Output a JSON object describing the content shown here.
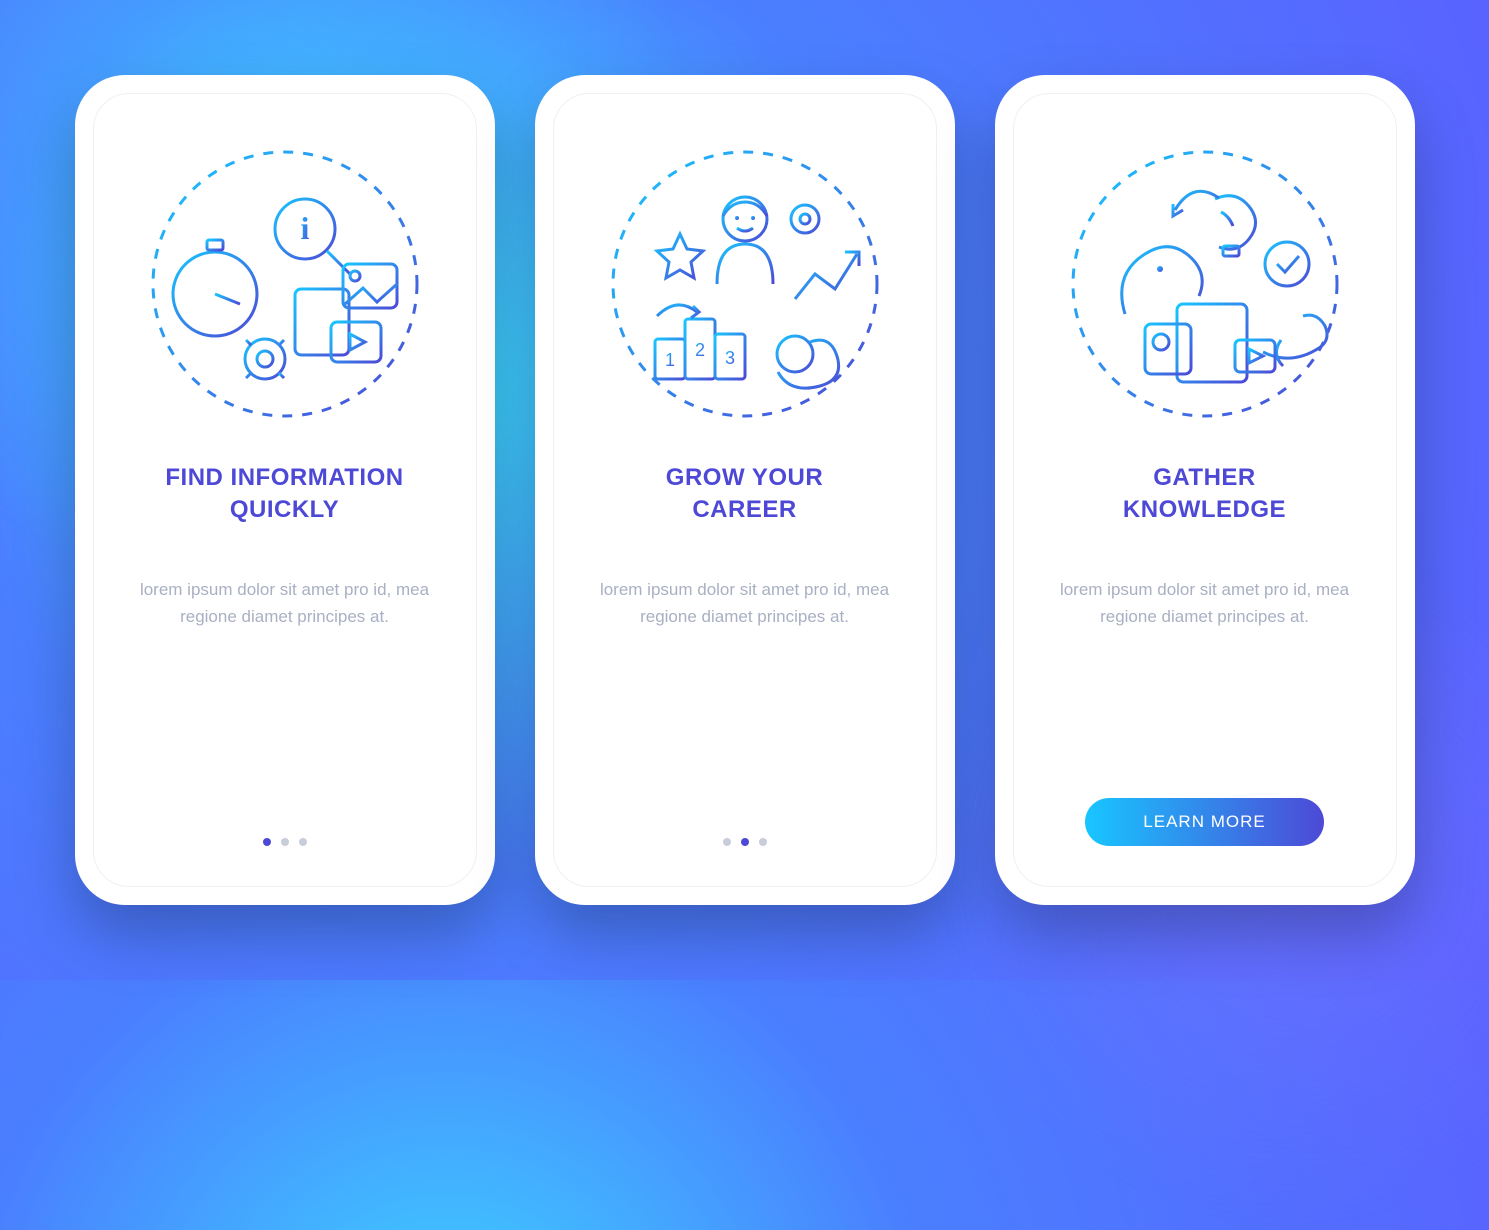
{
  "colors": {
    "title": "#4d49d6",
    "desc": "#a9b0c3",
    "dot_inactive": "#c7cdd9",
    "dot_active": "#4d49d6",
    "cta_grad_start": "#18c6ff",
    "cta_grad_end": "#4d49d6"
  },
  "screens": [
    {
      "illustration": "info-search-icon",
      "title": "FIND INFORMATION\nQUICKLY",
      "description": "lorem ipsum dolor sit amet pro id, mea regione diamet principes at.",
      "active_dot_index": 0,
      "dot_count": 3,
      "show_cta": false
    },
    {
      "illustration": "career-growth-icon",
      "title": "GROW YOUR\nCAREER",
      "description": "lorem ipsum dolor sit amet pro id, mea regione diamet principes at.",
      "active_dot_index": 1,
      "dot_count": 3,
      "show_cta": false
    },
    {
      "illustration": "knowledge-gather-icon",
      "title": "GATHER\nKNOWLEDGE",
      "description": "lorem ipsum dolor sit amet pro id, mea regione diamet principes at.",
      "active_dot_index": 2,
      "dot_count": 3,
      "show_cta": true
    }
  ],
  "cta_label": "LEARN MORE"
}
